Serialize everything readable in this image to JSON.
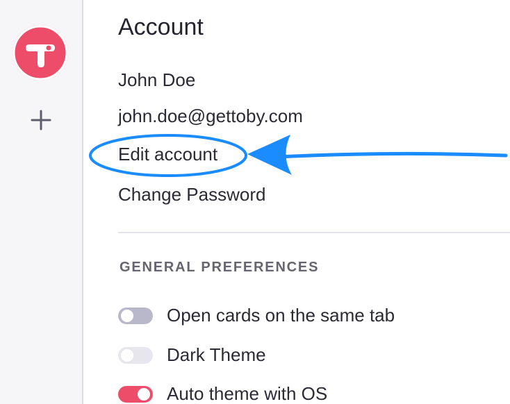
{
  "sidebar": {
    "logo_icon": "toby-logo-icon",
    "add_icon": "plus-icon"
  },
  "account": {
    "title": "Account",
    "name": "John Doe",
    "email": "john.doe@gettoby.com",
    "edit_label": "Edit account",
    "password_label": "Change Password"
  },
  "preferences": {
    "section_title": "GENERAL PREFERENCES",
    "items": [
      {
        "label": "Open cards on the same tab",
        "enabled": false
      },
      {
        "label": "Dark Theme",
        "enabled": false
      },
      {
        "label": "Auto theme with OS",
        "enabled": true
      }
    ]
  },
  "colors": {
    "accent": "#ee4d69",
    "annotation_blue": "#1a8cff"
  }
}
